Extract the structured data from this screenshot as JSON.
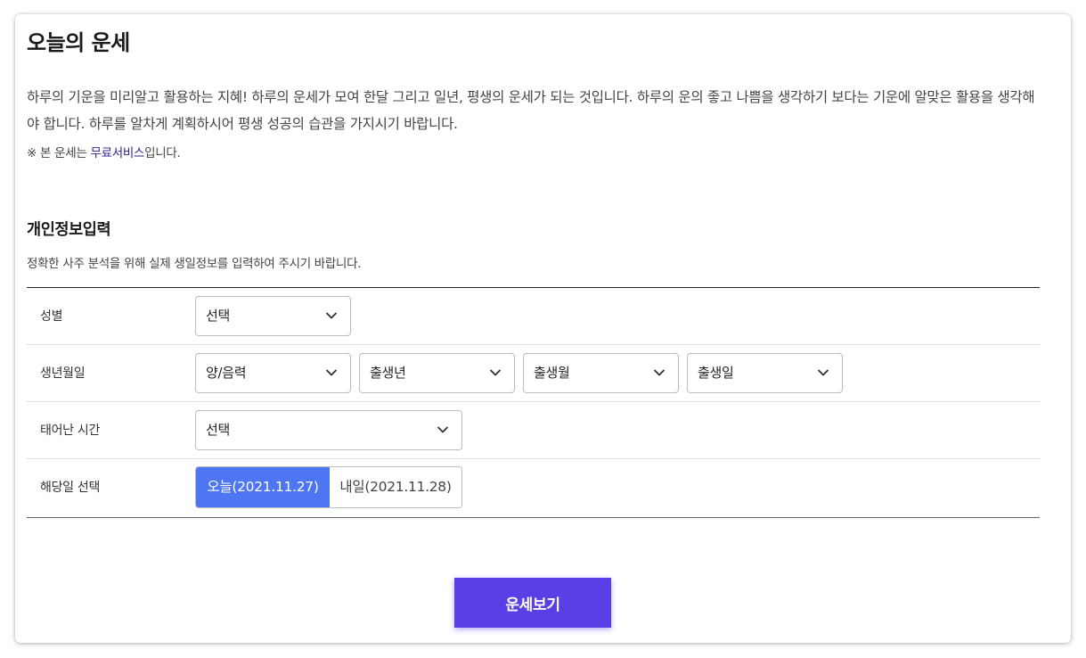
{
  "title": "오늘의 운세",
  "intro": "하루의 기운을 미리알고 활용하는 지혜! 하루의 운세가 모여 한달 그리고 일년, 평생의 운세가 되는 것입니다. 하루의 운의 좋고 나쁨을 생각하기 보다는 기운에 알맞은 활용을 생각해야 합니다. 하루를 알차게 계획하시어 평생 성공의 습관을 가지시기 바랍니다.",
  "notice": {
    "prefix": "※ 본 운세는 ",
    "link": "무료서비스",
    "suffix": "입니다."
  },
  "section": {
    "title": "개인정보입력",
    "description": "정확한 사주 분석을 위해 실제 생일정보를 입력하여 주시기 바랍니다."
  },
  "form": {
    "gender": {
      "label": "성별",
      "select": "선택"
    },
    "birthdate": {
      "label": "생년월일",
      "calendar": "양/음력",
      "year": "출생년",
      "month": "출생월",
      "day": "출생일"
    },
    "birthtime": {
      "label": "태어난 시간",
      "select": "선택"
    },
    "target_day": {
      "label": "해당일 선택",
      "today": "오늘(2021.11.27)",
      "tomorrow": "내일(2021.11.28)"
    }
  },
  "submit_label": "운세보기",
  "colors": {
    "accent_blue": "#4e76f3",
    "submit_purple": "#5a3ee6",
    "link": "#2a1f8f"
  },
  "icons": {
    "dropdown": "chevron-down-icon"
  }
}
